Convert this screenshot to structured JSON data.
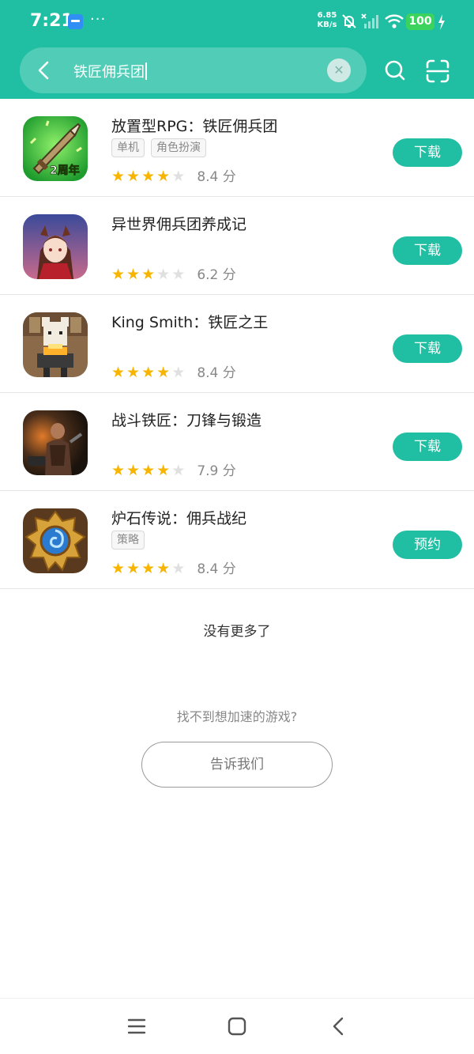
{
  "status_bar": {
    "time": "7:21",
    "more": "···",
    "net_speed_value": "6.85",
    "net_speed_unit": "KB/s",
    "battery": "100"
  },
  "search": {
    "query": "铁匠佣兵团"
  },
  "games": [
    {
      "name": "放置型RPG：铁匠佣兵团",
      "tags": [
        "单机",
        "角色扮演"
      ],
      "stars": 4,
      "score": "8.4 分",
      "action": "下载",
      "icon": "idle-rpg-sword-icon",
      "icon_badge": "2周年"
    },
    {
      "name": "异世界佣兵团养成记",
      "tags": [],
      "stars": 3,
      "score": "6.2 分",
      "action": "下载",
      "icon": "anime-girl-icon"
    },
    {
      "name": "King Smith：铁匠之王",
      "tags": [],
      "stars": 4,
      "score": "8.4 分",
      "action": "下载",
      "icon": "pixel-smith-icon"
    },
    {
      "name": "战斗铁匠：刀锋与锻造",
      "tags": [],
      "stars": 4,
      "score": "7.9 分",
      "action": "下载",
      "icon": "blacksmith-forge-icon"
    },
    {
      "name": "炉石传说：佣兵战纪",
      "tags": [
        "策略"
      ],
      "stars": 4,
      "score": "8.4 分",
      "action": "预约",
      "icon": "hearthstone-icon"
    }
  ],
  "footer": {
    "no_more": "没有更多了",
    "prompt": "找不到想加速的游戏?",
    "tell_button": "告诉我们"
  },
  "colors": {
    "accent": "#20bfa3",
    "star": "#f7b500",
    "battery": "#3bd35e"
  }
}
